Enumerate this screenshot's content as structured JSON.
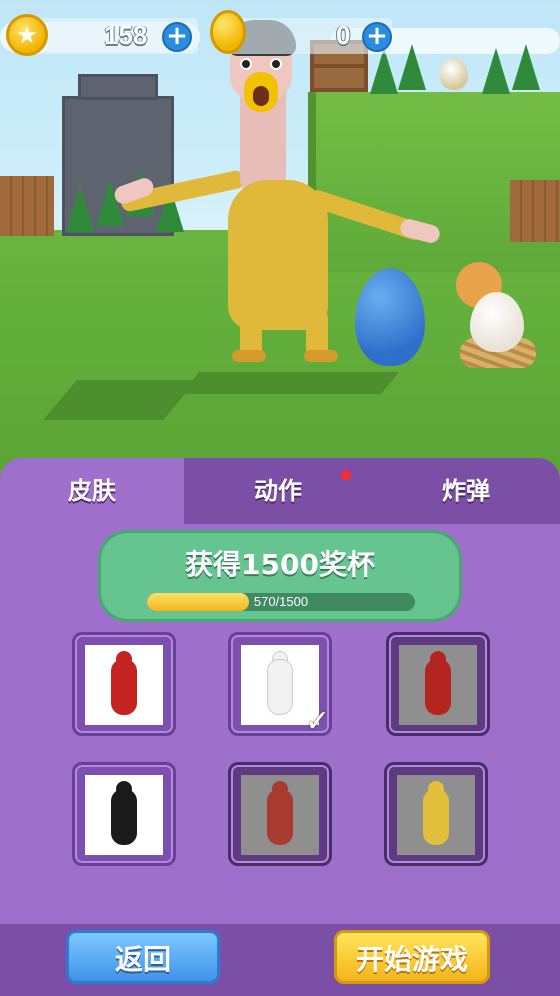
{
  "hud": {
    "trophies": "158",
    "coins": "0",
    "plus_symbol": "+",
    "trophy_icon": "star-icon",
    "coin_icon": "gold-coin-icon"
  },
  "tabs": [
    {
      "label": "皮肤",
      "active": true
    },
    {
      "label": "动作",
      "active": false,
      "notification": true
    },
    {
      "label": "炸弹",
      "active": false
    }
  ],
  "goal": {
    "title": "获得1500奖杯",
    "progress_text": "570/1500",
    "progress_value": 570,
    "progress_max": 1500
  },
  "skins": [
    {
      "color": "#c4231f",
      "locked": false,
      "selected": false
    },
    {
      "color": "#f2f2f2",
      "locked": false,
      "selected": true
    },
    {
      "color": "#b5251f",
      "locked": true,
      "selected": false
    },
    {
      "color": "#1a1a1a",
      "locked": false,
      "selected": false
    },
    {
      "color": "#a83a30",
      "locked": true,
      "selected": false
    },
    {
      "color": "#e2c03c",
      "locked": true,
      "selected": false
    }
  ],
  "check_symbol": "✓",
  "buttons": {
    "back": "返回",
    "start": "开始游戏"
  },
  "colors": {
    "panel": "#9f6fcc",
    "tab_bar": "#7b4fa6",
    "goal": "#66c491",
    "back_button": "#3f93e8",
    "start_button": "#f4b41a"
  }
}
